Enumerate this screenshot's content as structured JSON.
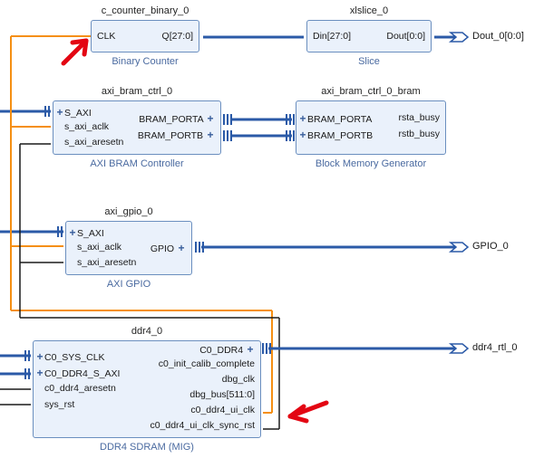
{
  "colors": {
    "block_bg": "#eaf1fb",
    "block_border": "#6b8fbf",
    "type_text": "#4a6aa0",
    "wire_blue": "#2b5aa7",
    "wire_orange": "#f58f13",
    "wire_black": "#1a1a1a",
    "arrow_red": "#e30613"
  },
  "blocks": {
    "counter": {
      "instance": "c_counter_binary_0",
      "type": "Binary Counter",
      "ports": {
        "clk": "CLK",
        "q": "Q[27:0]"
      }
    },
    "slice": {
      "instance": "xlslice_0",
      "type": "Slice",
      "ports": {
        "din": "Din[27:0]",
        "dout": "Dout[0:0]"
      }
    },
    "bram_ctrl": {
      "instance": "axi_bram_ctrl_0",
      "type": "AXI BRAM Controller",
      "ports": {
        "s_axi": "S_AXI",
        "aclk": "s_axi_aclk",
        "aresetn": "s_axi_aresetn",
        "porta": "BRAM_PORTA",
        "portb": "BRAM_PORTB"
      }
    },
    "bmg": {
      "instance": "axi_bram_ctrl_0_bram",
      "type": "Block Memory Generator",
      "ports": {
        "porta": "BRAM_PORTA",
        "portb": "BRAM_PORTB",
        "rsta": "rsta_busy",
        "rstb": "rstb_busy"
      }
    },
    "gpio": {
      "instance": "axi_gpio_0",
      "type": "AXI GPIO",
      "ports": {
        "s_axi": "S_AXI",
        "aclk": "s_axi_aclk",
        "aresetn": "s_axi_aresetn",
        "gpio": "GPIO"
      }
    },
    "ddr": {
      "instance": "ddr4_0",
      "type": "DDR4 SDRAM (MIG)",
      "ports": {
        "sys_clk": "C0_SYS_CLK",
        "s_axi": "C0_DDR4_S_AXI",
        "aresetn": "c0_ddr4_aresetn",
        "sys_rst": "sys_rst",
        "ddr4": "C0_DDR4",
        "init": "c0_init_calib_complete",
        "dbg_clk": "dbg_clk",
        "dbg_bus": "dbg_bus[511:0]",
        "ui_clk": "c0_ddr4_ui_clk",
        "ui_rst": "c0_ddr4_ui_clk_sync_rst"
      }
    }
  },
  "externals": {
    "dout": "Dout_0[0:0]",
    "gpio": "GPIO_0",
    "ddr4": "ddr4_rtl_0"
  }
}
